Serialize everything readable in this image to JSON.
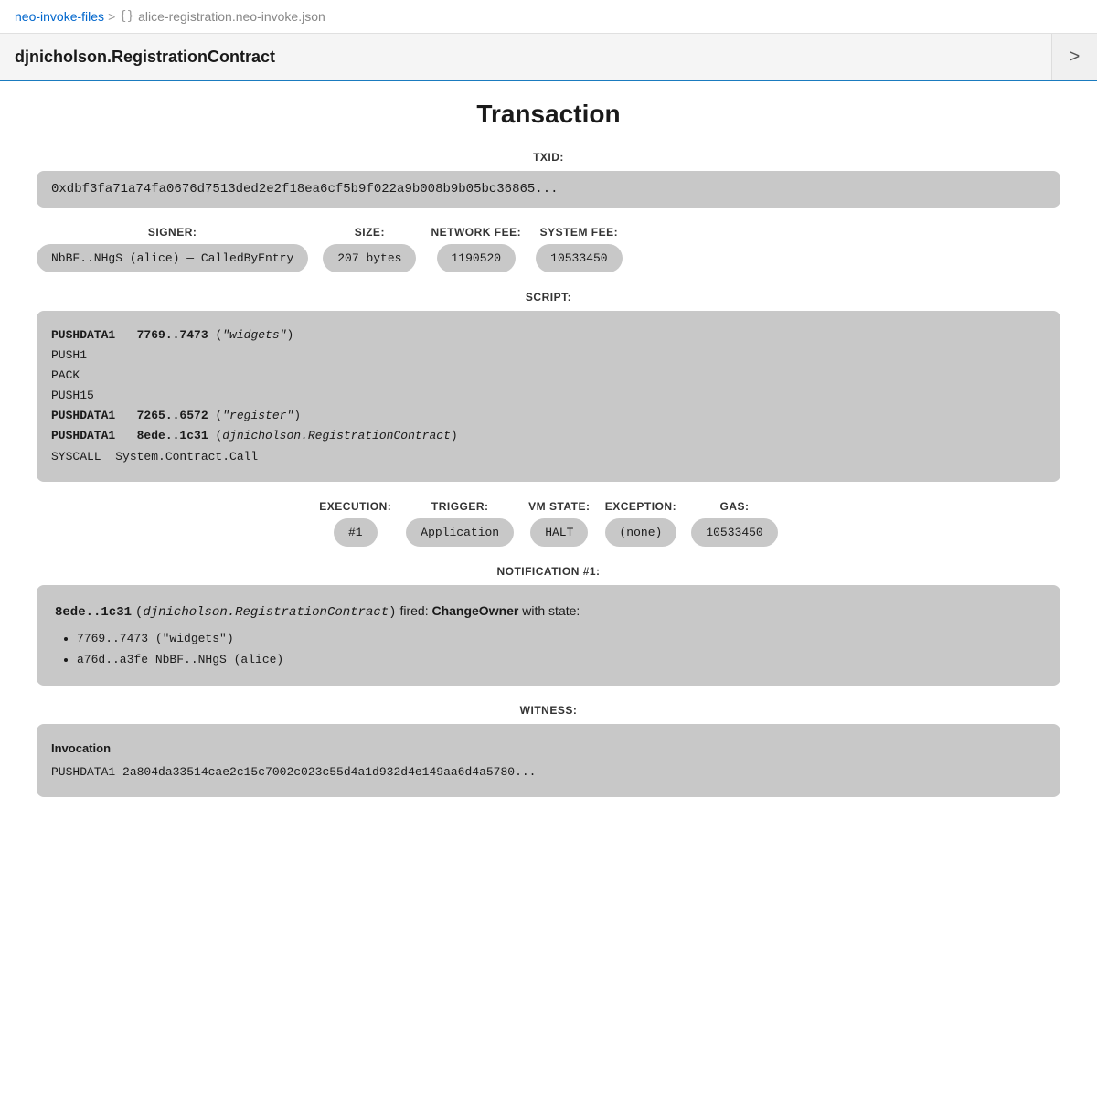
{
  "breadcrumb": {
    "parent": "neo-invoke-files",
    "separator": ">",
    "icon": "{}",
    "current": "alice-registration.neo-invoke.json"
  },
  "tab": {
    "input_value": "djnicholson.RegistrationContract",
    "arrow_label": ">"
  },
  "transaction": {
    "title": "Transaction",
    "txid_label": "TXID:",
    "txid_value": "0xdbf3fa71a74fa0676d7513ded2e2f18ea6cf5b9f022a9b008b9b05bc36865...",
    "signer_label": "SIGNER:",
    "signer_value": "NbBF..NHgS (alice) — CalledByEntry",
    "size_label": "SIZE:",
    "size_value": "207 bytes",
    "network_fee_label": "NETWORK FEE:",
    "network_fee_value": "1190520",
    "system_fee_label": "SYSTEM FEE:",
    "system_fee_value": "10533450",
    "script_label": "SCRIPT:",
    "script_lines": [
      {
        "opcode": "PUSHDATA1",
        "arg": "7769..7473",
        "note": "(\"widgets\")"
      },
      {
        "opcode": "PUSH1",
        "arg": "",
        "note": ""
      },
      {
        "opcode": "PACK",
        "arg": "",
        "note": ""
      },
      {
        "opcode": "PUSH15",
        "arg": "",
        "note": ""
      },
      {
        "opcode": "PUSHDATA1",
        "arg": "7265..6572",
        "note": "(\"register\")"
      },
      {
        "opcode": "PUSHDATA1",
        "arg": "8ede..1c31",
        "note": "(djnicholson.RegistrationContract)"
      },
      {
        "opcode": "SYSCALL",
        "arg": "System.Contract.Call",
        "note": ""
      }
    ],
    "execution_label": "EXECUTION:",
    "execution_value": "#1",
    "trigger_label": "TRIGGER:",
    "trigger_value": "Application",
    "vm_state_label": "VM STATE:",
    "vm_state_value": "HALT",
    "exception_label": "EXCEPTION:",
    "exception_value": "(none)",
    "gas_label": "GAS:",
    "gas_value": "10533450",
    "notification_label": "NOTIFICATION #1:",
    "notification_contract": "8ede..1c31",
    "notification_contract_name": "djnicholson.RegistrationContract",
    "notification_event": "ChangeOwner",
    "notification_state_items": [
      "7769..7473 (\"widgets\")",
      "a76d..a3fe NbBF..NHgS (alice)"
    ],
    "witness_label": "WITNESS:",
    "invocation_title": "Invocation",
    "invocation_line": "PUSHDATA1   2a804da33514cae2c15c7002c023c55d4a1d932d4e149aa6d4a5780..."
  }
}
